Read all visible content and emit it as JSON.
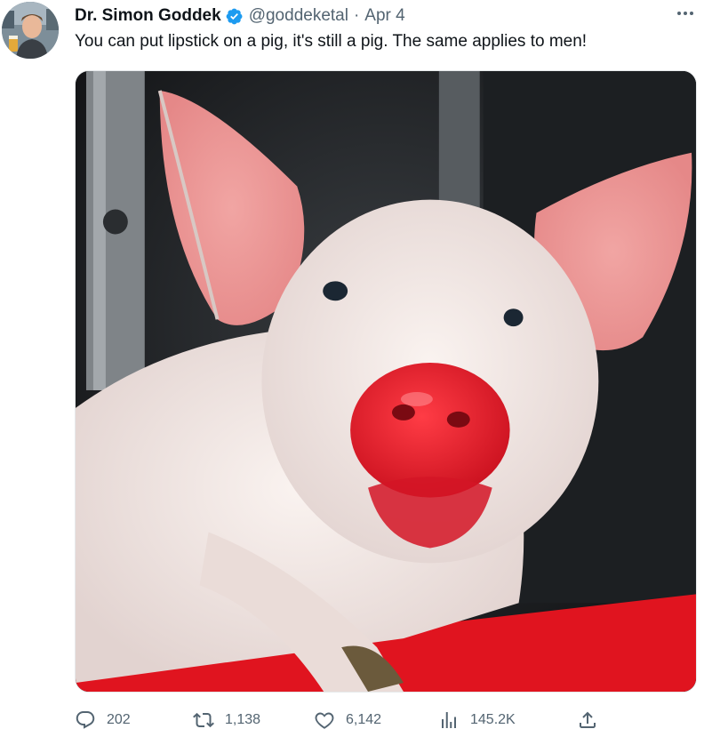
{
  "tweet": {
    "author_name": "Dr. Simon Goddek",
    "handle": "@goddeketal",
    "separator": "·",
    "date": "Apr 4",
    "text": "You can put lipstick on a pig, it's still a pig. The same applies to men!",
    "more_icon": "more-horizontal-icon",
    "verified_icon": "verified-badge-icon",
    "accent_color": "#1d9bf0"
  },
  "metrics": {
    "replies": "202",
    "reposts": "1,138",
    "likes": "6,142",
    "views": "145.2K"
  },
  "icons": {
    "reply": "reply-icon",
    "repost": "repost-icon",
    "like": "like-icon",
    "views": "views-icon",
    "share": "share-icon"
  }
}
